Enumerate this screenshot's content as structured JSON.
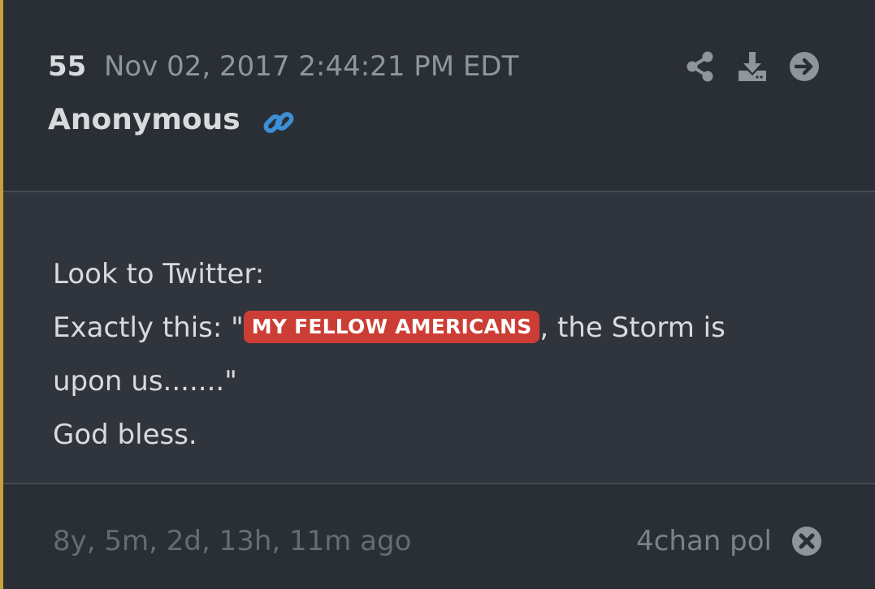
{
  "post": {
    "number": "55",
    "timestamp": "Nov 02, 2017 2:44:21 PM EDT",
    "author": "Anonymous"
  },
  "header_icons": [
    "share-icon",
    "download-icon",
    "arrow-right-circle-icon"
  ],
  "body": {
    "line1": "Look to Twitter:",
    "line2_prefix": "Exactly this: \"",
    "line2_highlight": "MY FELLOW AMERICANS",
    "line2_suffix": ", the Storm is",
    "line3": "upon us.......\"",
    "line4": "God bless."
  },
  "footer": {
    "elapsed": "8y, 5m, 2d, 13h, 11m ago",
    "source": "4chan pol"
  },
  "colors": {
    "accent_bar": "#c7a13a",
    "highlight": "#cc3d35",
    "link_icon": "#3b8fd6",
    "background": "#2a2e35",
    "body_background": "#30353d"
  }
}
